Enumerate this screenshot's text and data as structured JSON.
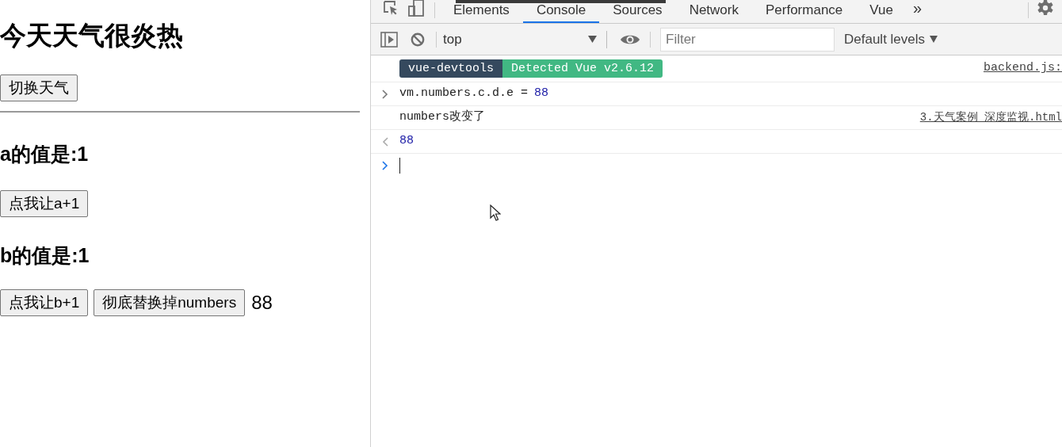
{
  "page": {
    "heading": "今天天气很炎热",
    "toggle_button": "切换天气",
    "a_heading": "a的值是:1",
    "a_button": "点我让a+1",
    "b_heading": "b的值是:1",
    "b_button": "点我让b+1",
    "replace_button": "彻底替换掉numbers",
    "value": "88"
  },
  "devtools": {
    "tabs": [
      {
        "label": "Elements",
        "selected": false
      },
      {
        "label": "Console",
        "selected": true
      },
      {
        "label": "Sources",
        "selected": false
      },
      {
        "label": "Network",
        "selected": false
      },
      {
        "label": "Performance",
        "selected": false
      },
      {
        "label": "Vue",
        "selected": false
      }
    ],
    "more_tabs": "»",
    "toolbar": {
      "context": "top",
      "filter_placeholder": "Filter",
      "levels": "Default levels"
    },
    "console": [
      {
        "kind": "badges",
        "badges": [
          "vue-devtools",
          "Detected Vue v2.6.12"
        ],
        "source": "backend.js:"
      },
      {
        "kind": "input",
        "text": "vm.numbers.c.d.e =",
        "value": "88"
      },
      {
        "kind": "log",
        "text": "numbers改变了",
        "source": "3.天气案例_深度监视.html"
      },
      {
        "kind": "result",
        "text": "88"
      },
      {
        "kind": "prompt"
      }
    ]
  }
}
